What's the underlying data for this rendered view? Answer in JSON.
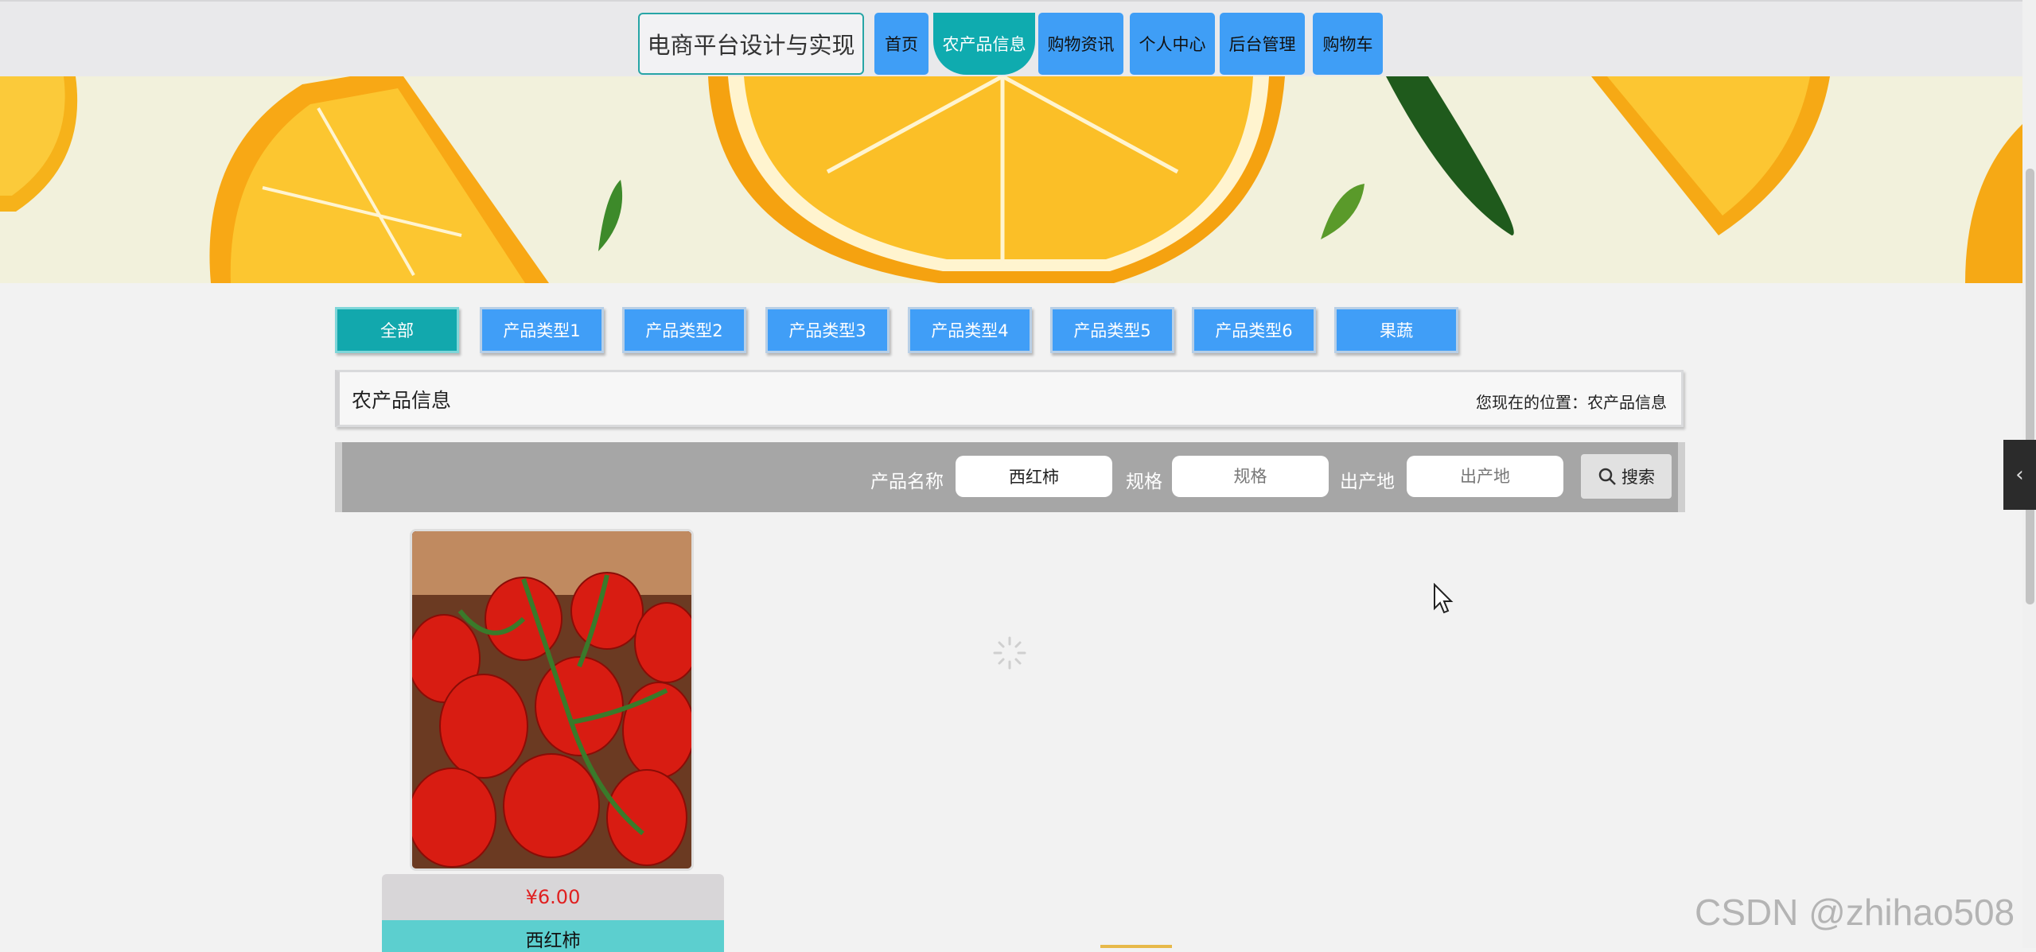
{
  "nav": {
    "brand": "电商平台设计与实现",
    "items": [
      {
        "label": "首页"
      },
      {
        "label": "农产品信息",
        "active": true
      },
      {
        "label": "购物资讯"
      },
      {
        "label": "个人中心"
      },
      {
        "label": "后台管理"
      },
      {
        "label": "购物车"
      }
    ]
  },
  "categories": [
    {
      "label": "全部",
      "active": true
    },
    {
      "label": "产品类型1"
    },
    {
      "label": "产品类型2"
    },
    {
      "label": "产品类型3"
    },
    {
      "label": "产品类型4"
    },
    {
      "label": "产品类型5"
    },
    {
      "label": "产品类型6"
    },
    {
      "label": "果蔬"
    }
  ],
  "breadcrumb": {
    "title": "农产品信息",
    "location": "您现在的位置：农产品信息"
  },
  "search": {
    "name_label": "产品名称",
    "name_value": "西红柿",
    "spec_label": "规格",
    "spec_placeholder": "规格",
    "origin_label": "出产地",
    "origin_placeholder": "出产地",
    "button_label": "搜索"
  },
  "products": [
    {
      "price": "¥6.00",
      "name": "西红柿"
    }
  ],
  "watermark": "CSDN @zhihao508",
  "colors": {
    "nav_blue": "#3f9ef6",
    "teal_active": "#0fabaf",
    "price_red": "#e02020",
    "name_bar": "#5ccfcf"
  }
}
